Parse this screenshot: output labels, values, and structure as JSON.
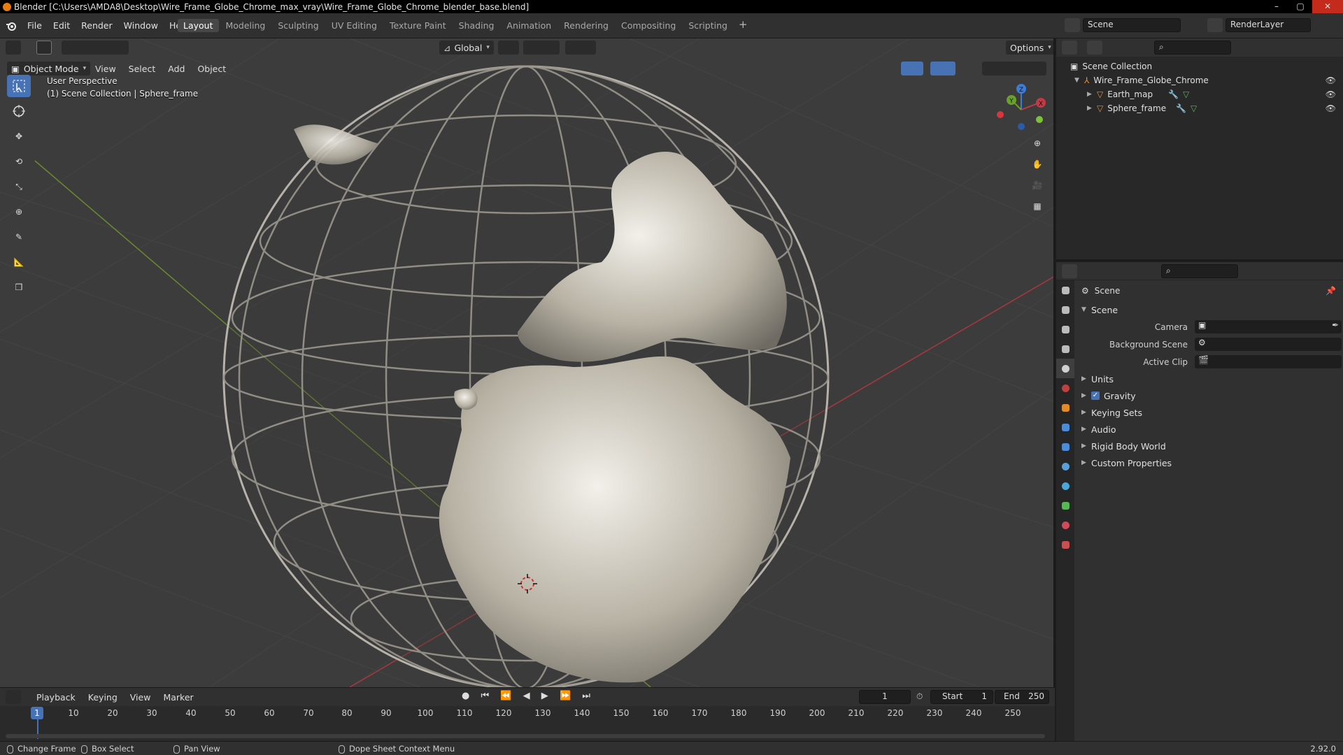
{
  "window": {
    "title": "Blender [C:\\Users\\AMDA8\\Desktop\\Wire_Frame_Globe_Chrome_max_vray\\Wire_Frame_Globe_Chrome_blender_base.blend]",
    "minimize": "–",
    "maximize": "▢",
    "close": "✕"
  },
  "menu": [
    "File",
    "Edit",
    "Render",
    "Window",
    "Help"
  ],
  "workspaces": {
    "tabs": [
      "Layout",
      "Modeling",
      "Sculpting",
      "UV Editing",
      "Texture Paint",
      "Shading",
      "Animation",
      "Rendering",
      "Compositing",
      "Scripting"
    ],
    "active": "Layout",
    "add": "+"
  },
  "scene_field": "Scene",
  "render_layer_field": "RenderLayer",
  "viewport": {
    "transform_orientation": "Global",
    "options_label": "Options",
    "mode": "Object Mode",
    "header_menu": [
      "View",
      "Select",
      "Add",
      "Object"
    ],
    "overlay_line1": "User Perspective",
    "overlay_line2": "(1) Scene Collection | Sphere_frame",
    "gizmo": {
      "x": "X",
      "y": "Y",
      "z": "Z"
    }
  },
  "outliner": {
    "root": "Scene Collection",
    "collection": "Wire_Frame_Globe_Chrome",
    "objects": [
      "Earth_map",
      "Sphere_frame"
    ]
  },
  "properties": {
    "context_title": "Scene",
    "panel_title": "Scene",
    "fields": [
      {
        "label": "Camera"
      },
      {
        "label": "Background Scene"
      },
      {
        "label": "Active Clip"
      }
    ],
    "sections": [
      "Units",
      "Gravity",
      "Keying Sets",
      "Audio",
      "Rigid Body World",
      "Custom Properties"
    ],
    "gravity_checked": true,
    "tab_colors": [
      "#bbbbbb",
      "#bbbbbb",
      "#bbbbbb",
      "#bbbbbb",
      "#d0d0d0",
      "#c04040",
      "#e08a2c",
      "#4a8cd8",
      "#4a8cd8",
      "#5aa0d8",
      "#4aa8d8",
      "#56b856",
      "#d04a5a",
      "#c85050"
    ]
  },
  "timeline": {
    "menu": [
      "Playback",
      "Keying",
      "View",
      "Marker"
    ],
    "current_frame": "1",
    "start_label": "Start",
    "start": "1",
    "end_label": "End",
    "end": "250",
    "ticks": [
      "10",
      "20",
      "30",
      "40",
      "50",
      "60",
      "70",
      "80",
      "90",
      "100",
      "110",
      "120",
      "130",
      "140",
      "150",
      "160",
      "170",
      "180",
      "190",
      "200",
      "210",
      "220",
      "230",
      "240",
      "250"
    ],
    "playhead_frame": "1"
  },
  "statusbar": {
    "change_frame": "Change Frame",
    "box_select": "Box Select",
    "pan_view": "Pan View",
    "context_menu": "Dope Sheet Context Menu",
    "version": "2.92.0"
  }
}
